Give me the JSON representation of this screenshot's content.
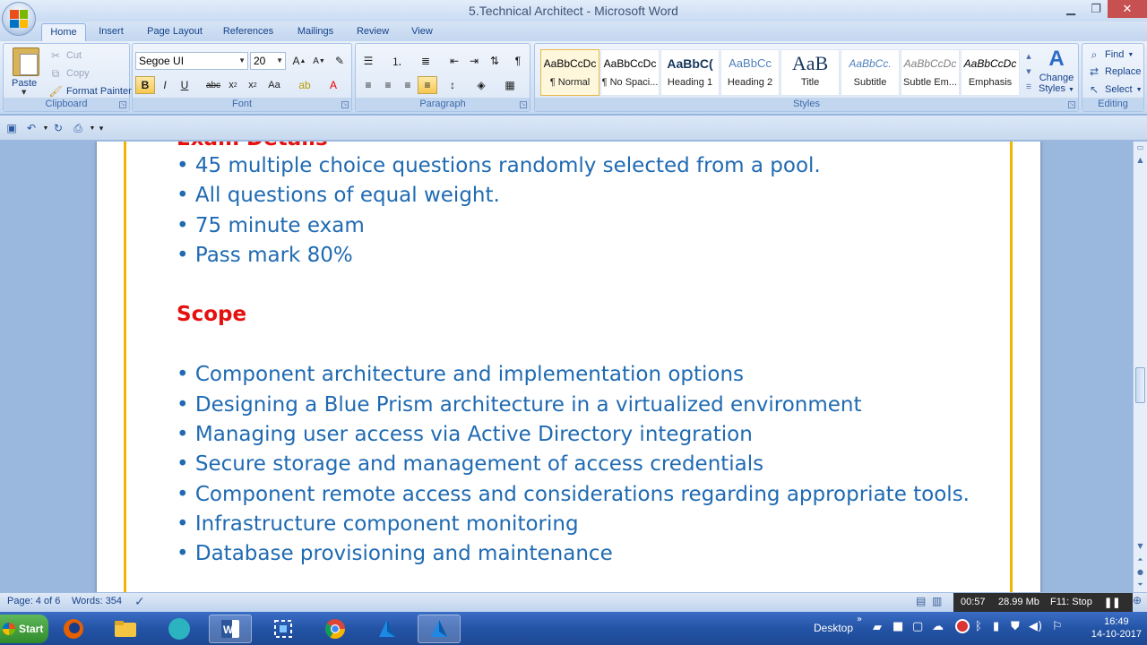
{
  "window": {
    "title": "5.Technical Architect - Microsoft Word"
  },
  "tabs": [
    "Home",
    "Insert",
    "Page Layout",
    "References",
    "Mailings",
    "Review",
    "View"
  ],
  "ribbon": {
    "clipboard": {
      "label": "Clipboard",
      "paste": "Paste",
      "cut": "Cut",
      "copy": "Copy",
      "format_painter": "Format Painter"
    },
    "font": {
      "label": "Font",
      "name": "Segoe UI",
      "size": "20"
    },
    "paragraph": {
      "label": "Paragraph"
    },
    "styles": {
      "label": "Styles",
      "items": [
        {
          "preview": "AaBbCcDc",
          "name": "¶ Normal"
        },
        {
          "preview": "AaBbCcDc",
          "name": "¶ No Spaci..."
        },
        {
          "preview": "AaBbC(",
          "name": "Heading 1"
        },
        {
          "preview": "AaBbCc",
          "name": "Heading 2"
        },
        {
          "preview": "AaB",
          "name": "Title"
        },
        {
          "preview": "AaBbCc.",
          "name": "Subtitle"
        },
        {
          "preview": "AaBbCcDc",
          "name": "Subtle Em..."
        },
        {
          "preview": "AaBbCcDc",
          "name": "Emphasis"
        }
      ],
      "change_styles_line1": "Change",
      "change_styles_line2": "Styles"
    },
    "editing": {
      "label": "Editing",
      "find": "Find",
      "replace": "Replace",
      "select": "Select"
    }
  },
  "document": {
    "exam_heading": "Exam Details",
    "exam_bullets": [
      "• 45 multiple choice questions randomly selected from a pool.",
      "• All questions of equal weight.",
      "• 75 minute exam",
      "• Pass mark 80%"
    ],
    "scope_heading": "Scope",
    "scope_bullets": [
      "• Component architecture and implementation options",
      "• Designing a Blue Prism architecture in a virtualized environment",
      "• Managing user access via Active Directory integration",
      "• Secure storage and management of access credentials",
      "• Component remote access and considerations regarding appropriate tools.",
      "• Infrastructure component monitoring",
      "• Database provisioning and maintenance"
    ]
  },
  "status": {
    "page": "Page: 4 of 6",
    "words": "Words: 354",
    "recording": {
      "time": "00:57",
      "size": "28.99 Mb",
      "stop": "F11: Stop"
    }
  },
  "taskbar": {
    "start": "Start",
    "desktop": "Desktop",
    "time": "16:49",
    "date": "14-10-2017"
  },
  "colors": {
    "heading": "#e4110f",
    "bullet_text": "#1f6ab2",
    "page_border": "#f3b400",
    "ribbon_text": "#15428b"
  }
}
